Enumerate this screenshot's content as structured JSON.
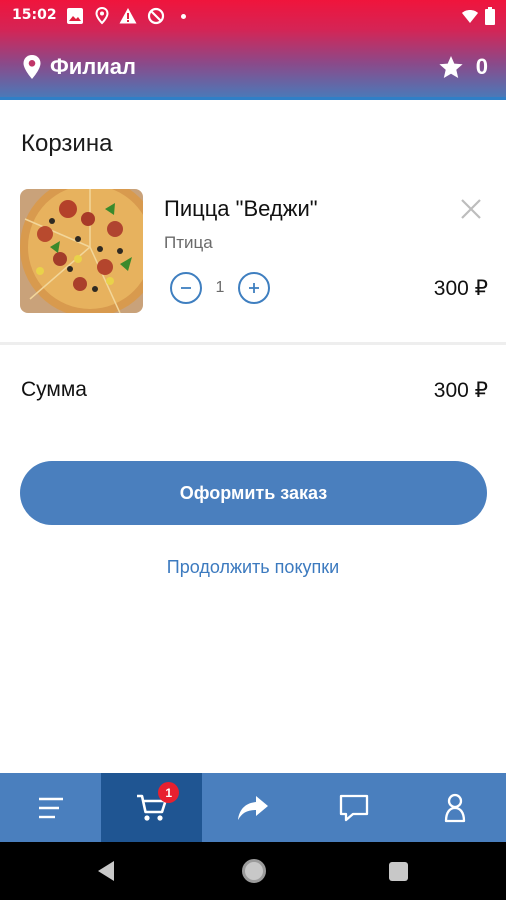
{
  "status_bar": {
    "time": "15:02"
  },
  "toolbar": {
    "branch_label": "Филиал",
    "favorites_count": "0"
  },
  "cart": {
    "title": "Корзина",
    "items": [
      {
        "name": "Пицца \"Веджи\"",
        "subtitle": "Птица",
        "quantity": "1",
        "price": "300 ₽"
      }
    ],
    "sum_label": "Сумма",
    "sum_value": "300 ₽",
    "checkout_label": "Оформить заказ",
    "continue_label": "Продолжить покупки"
  },
  "bottom_nav": {
    "items": [
      "menu-icon",
      "cart-icon",
      "share-icon",
      "chat-icon",
      "profile-icon"
    ],
    "active": "cart-icon",
    "cart_badge": "1"
  },
  "colors": {
    "accent": "#4a7fbe",
    "nav_active": "#1f5592",
    "badge": "#e8202f",
    "header_top": "#f0143c",
    "header_bottom": "#4a7ab9"
  }
}
